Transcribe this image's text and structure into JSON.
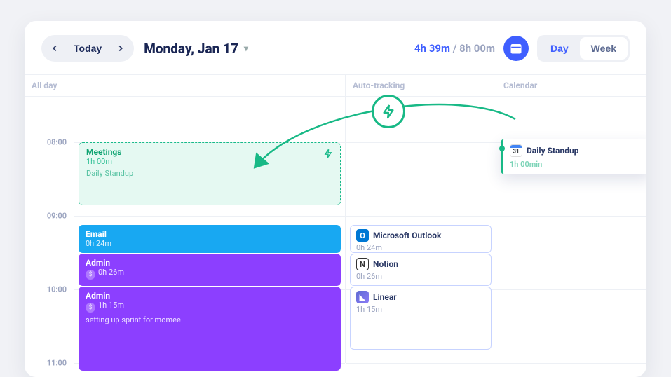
{
  "header": {
    "today_label": "Today",
    "date_title": "Monday, Jan 17",
    "tracked_hours": "4h 39m",
    "total_hours": "8h 00m",
    "cal_day": "31",
    "view_day": "Day",
    "view_week": "Week"
  },
  "columns": {
    "allday": "All day",
    "auto": "Auto-tracking",
    "calendar": "Calendar"
  },
  "time_labels": [
    "08:00",
    "09:00",
    "10:00",
    "11:00"
  ],
  "events": {
    "meetings": {
      "title": "Meetings",
      "duration": "1h 00m",
      "subtitle": "Daily Standup"
    },
    "email": {
      "title": "Email",
      "duration": "0h 24m"
    },
    "admin1": {
      "title": "Admin",
      "duration": "0h 26m"
    },
    "admin2": {
      "title": "Admin",
      "duration": "1h 15m",
      "subtitle": "setting up sprint for momee"
    }
  },
  "apps": {
    "outlook": {
      "name": "Microsoft Outlook",
      "duration": "0h 24m"
    },
    "notion": {
      "name": "Notion",
      "duration": "0h 26m"
    },
    "linear": {
      "name": "Linear",
      "duration": "1h 15m"
    }
  },
  "calendar_event": {
    "title": "Daily Standup",
    "duration": "1h 00min"
  }
}
